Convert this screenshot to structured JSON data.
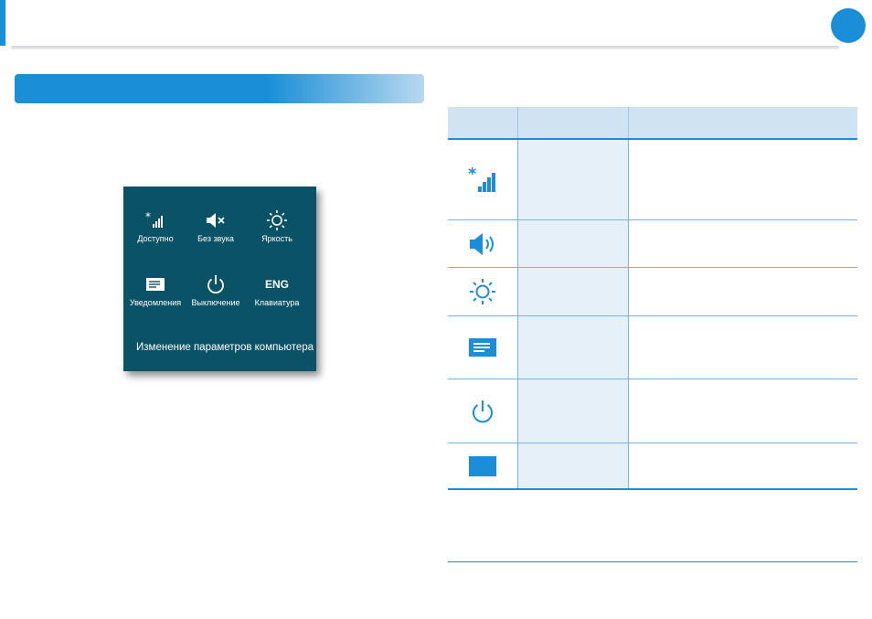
{
  "colors": {
    "accent": "#1a8fd8",
    "panel": "#0a5266",
    "cell": "#e6f0f9",
    "header": "#cfe3f3"
  },
  "charm_panel": {
    "items": [
      {
        "icon": "network-bars-icon",
        "label": "Доступно"
      },
      {
        "icon": "mute-speaker-icon",
        "label": "Без звука"
      },
      {
        "icon": "brightness-sun-icon",
        "label": "Яркость"
      },
      {
        "icon": "notifications-icon",
        "label": "Уведомления"
      },
      {
        "icon": "power-icon",
        "label": "Выключение"
      },
      {
        "icon": "keyboard-language-icon",
        "text": "ENG",
        "label": "Клавиатура"
      }
    ],
    "footer": "Изменение параметров компьютера"
  },
  "table": {
    "rows": [
      {
        "icon": "network-bars-icon"
      },
      {
        "icon": "speaker-volume-icon"
      },
      {
        "icon": "brightness-sun-icon"
      },
      {
        "icon": "notifications-icon"
      },
      {
        "icon": "power-icon"
      },
      {
        "icon": "keyboard-square-icon"
      }
    ]
  }
}
